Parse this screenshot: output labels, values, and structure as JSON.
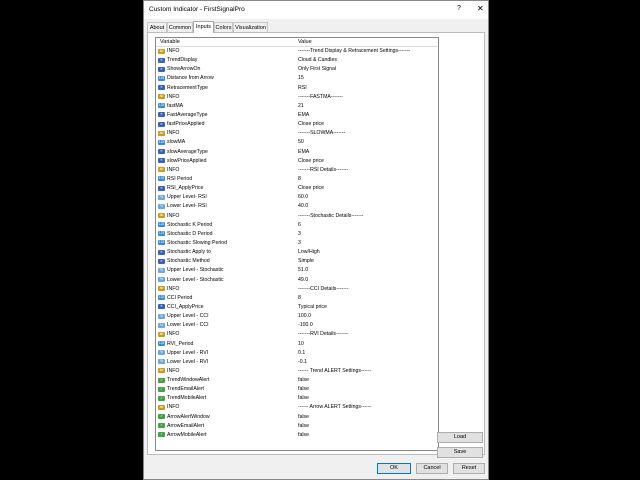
{
  "window": {
    "title": "Custom Indicator - FirstSignalPro",
    "help": "?",
    "close": "✕"
  },
  "tabs": [
    {
      "label": "About"
    },
    {
      "label": "Common"
    },
    {
      "label": "Inputs"
    },
    {
      "label": "Colors"
    },
    {
      "label": "Visualization"
    }
  ],
  "active_tab": "Inputs",
  "table": {
    "col_variable": "Variable",
    "col_value": "Value",
    "rows": [
      {
        "type": "ab",
        "variable": "INFO",
        "value": "-------Trend Display & Retracement Settings-------"
      },
      {
        "type": "enum",
        "variable": "TrendDisplay",
        "value": "Cloud & Candles"
      },
      {
        "type": "enum",
        "variable": "ShowArrowOn",
        "value": "Only First Signal"
      },
      {
        "type": "num",
        "variable": "Distance from Arrow",
        "value": "15"
      },
      {
        "type": "enum",
        "variable": "RetracementType",
        "value": "RSI"
      },
      {
        "type": "ab",
        "variable": "INFO",
        "value": "-------FASTMA-------"
      },
      {
        "type": "num",
        "variable": "fastMA",
        "value": "21"
      },
      {
        "type": "enum",
        "variable": "FastAverageType",
        "value": "EMA"
      },
      {
        "type": "enum",
        "variable": "fastPriceApplied",
        "value": "Close price"
      },
      {
        "type": "ab",
        "variable": "INFO",
        "value": "-------SLOWMA-------"
      },
      {
        "type": "num",
        "variable": "slowMA",
        "value": "50"
      },
      {
        "type": "enum",
        "variable": "slowAverageType",
        "value": "EMA"
      },
      {
        "type": "enum",
        "variable": "slowPriceApplied",
        "value": "Close price"
      },
      {
        "type": "ab",
        "variable": "INFO",
        "value": "-------RSI Details-------"
      },
      {
        "type": "num",
        "variable": "RSI Period",
        "value": "8"
      },
      {
        "type": "enum",
        "variable": "RSI_ApplyPrice",
        "value": "Close price"
      },
      {
        "type": "dbl",
        "variable": "Upper Level- RSI",
        "value": "60.0"
      },
      {
        "type": "dbl",
        "variable": "Lower Level- RSI",
        "value": "40.0"
      },
      {
        "type": "ab",
        "variable": "INFO",
        "value": "-------Stochastic Details-------"
      },
      {
        "type": "num",
        "variable": "Stochastic K Period",
        "value": "6"
      },
      {
        "type": "num",
        "variable": "Stochastic D Period",
        "value": "3"
      },
      {
        "type": "num",
        "variable": "Stochastic Slowing Period",
        "value": "3"
      },
      {
        "type": "enum",
        "variable": "Stochastic Apply to",
        "value": "Low/High"
      },
      {
        "type": "enum",
        "variable": "Stochastic Method",
        "value": "Simple"
      },
      {
        "type": "dbl",
        "variable": "Upper Level - Stochastic",
        "value": "51.0"
      },
      {
        "type": "dbl",
        "variable": "Lower Level - Stochastic",
        "value": "49.0"
      },
      {
        "type": "ab",
        "variable": "INFO",
        "value": "-------CCI Details-------"
      },
      {
        "type": "num",
        "variable": "CCI Period",
        "value": "8"
      },
      {
        "type": "enum",
        "variable": "CCI_ApplyPrice",
        "value": "Typical price"
      },
      {
        "type": "dbl",
        "variable": "Upper Level - CCI",
        "value": "100.0"
      },
      {
        "type": "dbl",
        "variable": "Lower Level - CCI",
        "value": "-100.0"
      },
      {
        "type": "ab",
        "variable": "INFO",
        "value": "-------RVI Details-------"
      },
      {
        "type": "num",
        "variable": "RVI_Period",
        "value": "10"
      },
      {
        "type": "dbl",
        "variable": "Upper Level - RVI",
        "value": "0.1"
      },
      {
        "type": "dbl",
        "variable": "Lower Level - RVI",
        "value": "-0.1"
      },
      {
        "type": "ab",
        "variable": "INFO",
        "value": "------ Trend ALERT Settings------"
      },
      {
        "type": "bool",
        "variable": "TrendWindowAlert",
        "value": "false"
      },
      {
        "type": "bool",
        "variable": "TrendEmailAlert",
        "value": "false"
      },
      {
        "type": "bool",
        "variable": "TrendMobileAlert",
        "value": "false"
      },
      {
        "type": "ab",
        "variable": "INFO",
        "value": "------ Arrow ALERT Settings------"
      },
      {
        "type": "bool",
        "variable": "ArrowAlertWindow",
        "value": "false"
      },
      {
        "type": "bool",
        "variable": "ArrowEmailAlert",
        "value": "false"
      },
      {
        "type": "bool",
        "variable": "ArrowMobileAlert",
        "value": "false"
      }
    ]
  },
  "type_labels": {
    "ab": "ab",
    "enum": "≡",
    "num": "123",
    "dbl": "½",
    "bool": "✓"
  },
  "buttons": {
    "load": "Load",
    "save": "Save",
    "ok": "OK",
    "cancel": "Cancel",
    "reset": "Reset"
  }
}
